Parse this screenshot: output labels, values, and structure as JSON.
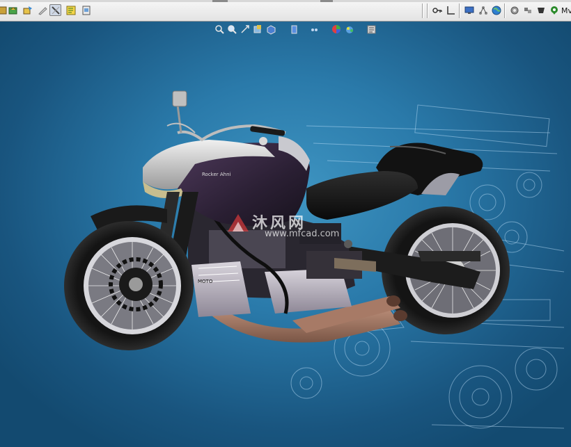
{
  "toolbar": {
    "right_label": "Mv",
    "left_buttons": [
      "select-filter-icon",
      "rebuild-icon",
      "options-icon",
      "sketch-icon",
      "smart-dimension-icon",
      "relations-icon",
      "display-icon"
    ],
    "right_buttons": [
      "key-icon",
      "axis-icon",
      "monitor-icon",
      "assembly-icon",
      "globe-icon",
      "gear-icon",
      "parts-icon",
      "cup-icon",
      "map-pin-icon"
    ]
  },
  "hud": {
    "buttons": [
      "zoom-fit-icon",
      "zoom-area-icon",
      "pan-icon",
      "section-view-icon",
      "view-orientation-icon",
      "display-style-icon",
      "hide-show-icon",
      "appearance-icon",
      "scene-icon",
      "view-settings-icon"
    ]
  },
  "watermark": {
    "main": "沐风网",
    "url": "www.mfcad.com"
  },
  "model": {
    "tank_badge": "Rocker Ahni",
    "engine_badge": "MOTO"
  },
  "colors": {
    "viewport_bg": "#2a7aaa",
    "bike_body": "#1e1a24",
    "bike_tank": "#3b2b45",
    "silver": "#bdbdbd",
    "exhaust": "#9a6e5c"
  }
}
